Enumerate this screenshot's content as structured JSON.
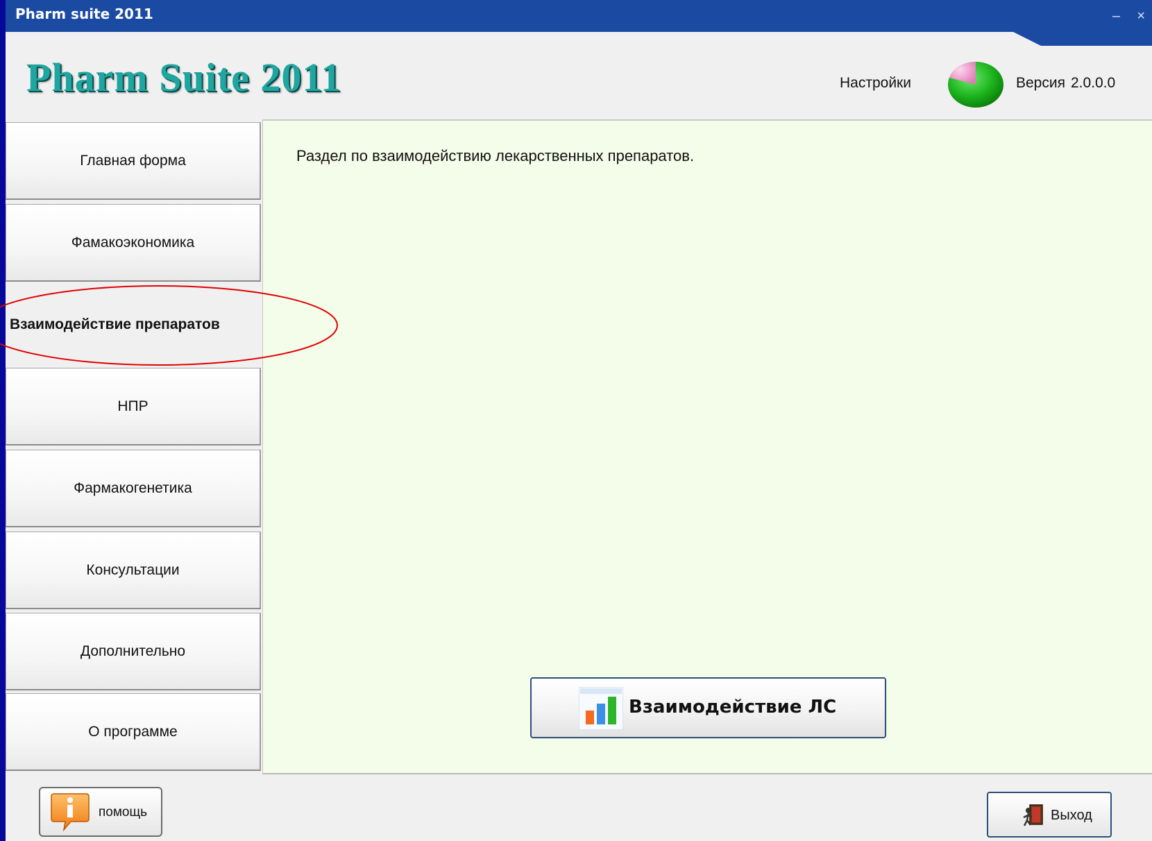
{
  "window": {
    "title": "Pharm suite 2011",
    "minimize_glyph": "–",
    "close_glyph": "×"
  },
  "header": {
    "logo_text": "Pharm Suite 2011",
    "settings_label": "Настройки",
    "version_label": "Версия",
    "version_number": "2.0.0.0"
  },
  "sidebar": {
    "items": [
      {
        "label": "Главная форма"
      },
      {
        "label": "Фамакоэкономика"
      },
      {
        "label": "Взаимодействие препаратов"
      },
      {
        "label": "НПР"
      },
      {
        "label": "Фармакогенетика"
      },
      {
        "label": "Консультации"
      },
      {
        "label": "Дополнительно"
      },
      {
        "label": "О программе"
      }
    ],
    "active_index": 2
  },
  "content": {
    "description": "Раздел по взаимодействию лекарственных препаратов.",
    "action_button_label": "Взаимодействие ЛС",
    "action_button_icon": "bar-chart-icon"
  },
  "footer": {
    "help_label": "помощь",
    "help_icon": "info-icon",
    "exit_label": "Выход",
    "exit_icon": "exit-door-icon"
  },
  "colors": {
    "titlebar": "#1b4aa3",
    "background": "#07079a",
    "content_bg": "#f4fcea",
    "logo": "#1fa6a0",
    "highlight": "#e00000"
  }
}
